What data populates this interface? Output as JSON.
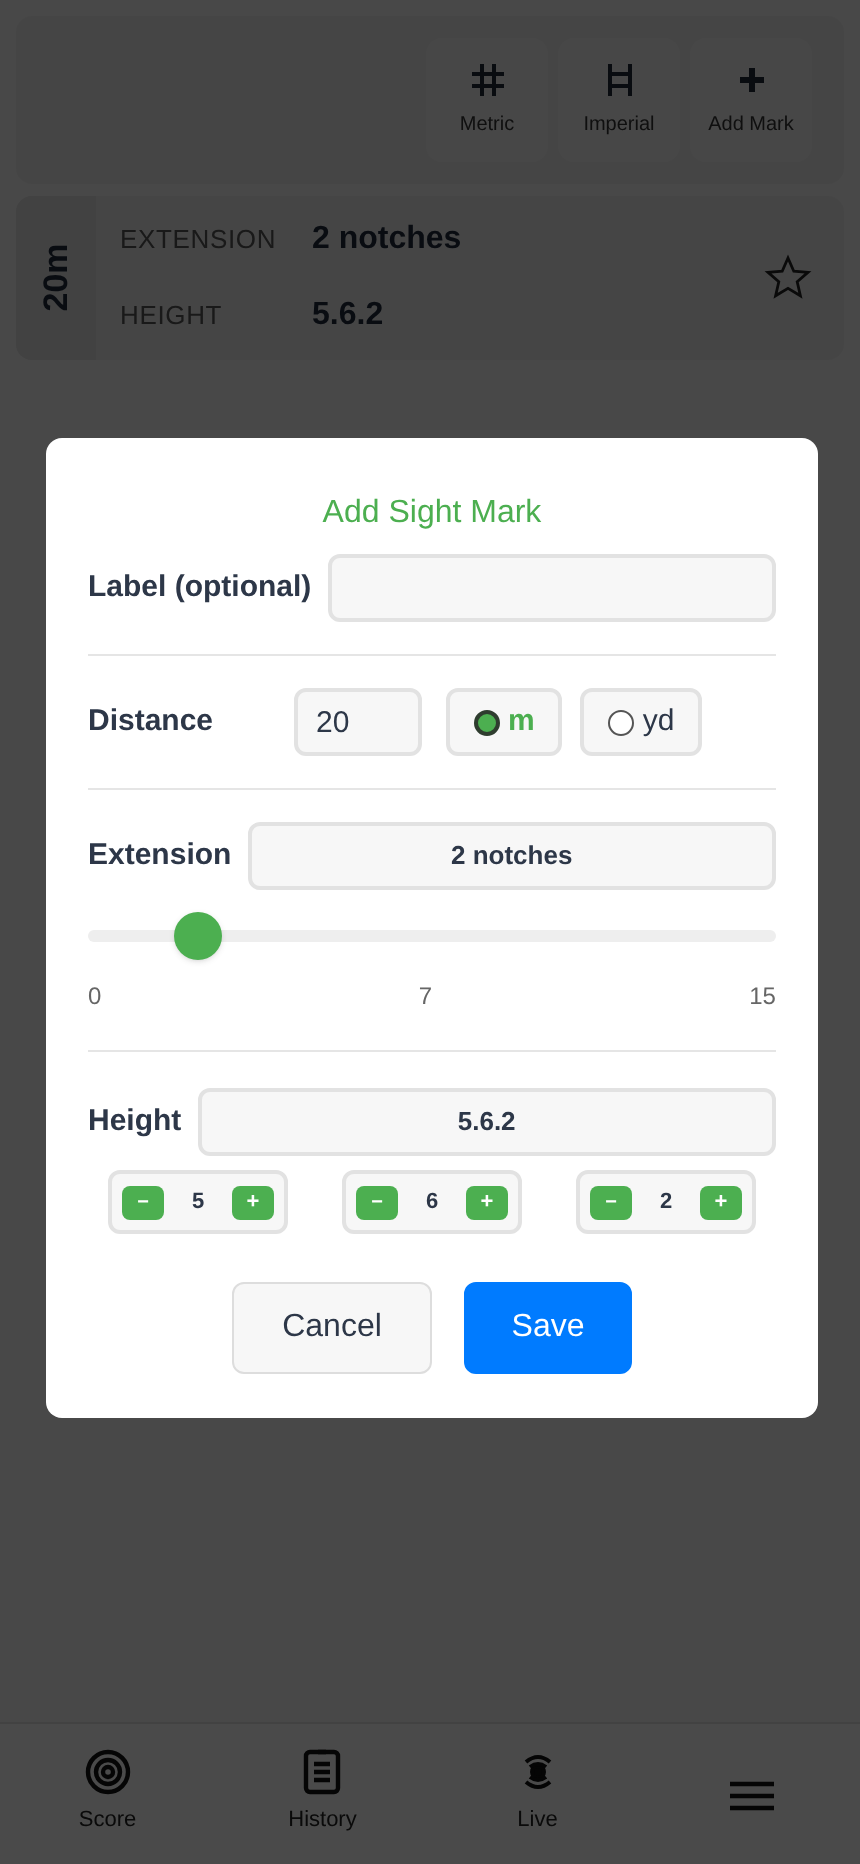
{
  "toolbar": [
    {
      "kind": "hash",
      "label": "Metric"
    },
    {
      "kind": "ladder",
      "label": "Imperial"
    },
    {
      "kind": "plus",
      "label": "Add Mark"
    }
  ],
  "sight_mark": {
    "distance": "20m",
    "rows": [
      {
        "label": "EXTENSION",
        "value": "2 notches"
      },
      {
        "label": "HEIGHT",
        "value": "5.6.2"
      }
    ],
    "starred": false
  },
  "dialog": {
    "title": "Add Sight Mark",
    "label_field": {
      "label": "Label (optional)"
    },
    "distance": {
      "label": "Distance",
      "value": "20",
      "units": [
        {
          "label": "m",
          "selected": true
        },
        {
          "label": "yd",
          "selected": false
        }
      ]
    },
    "extension": {
      "label": "Extension",
      "value": "2 notches",
      "level": 0.133,
      "ticks": [
        "0",
        "7",
        "15"
      ]
    },
    "height": {
      "label": "Height",
      "value": "5.6.2",
      "steppers": [
        {
          "minus": "−",
          "value": "5",
          "plus": "+"
        },
        {
          "minus": "−",
          "value": "6",
          "plus": "+"
        },
        {
          "minus": "−",
          "value": "2",
          "plus": "+"
        }
      ]
    },
    "buttons": [
      {
        "kind": "secondary",
        "label": "Cancel"
      },
      {
        "kind": "primary",
        "label": "Save"
      }
    ]
  },
  "bottom_nav": [
    {
      "kind": "target",
      "label": "Score"
    },
    {
      "kind": "clipboard",
      "label": "History"
    },
    {
      "kind": "broadcast",
      "label": "Live"
    },
    {
      "kind": "menu"
    }
  ]
}
